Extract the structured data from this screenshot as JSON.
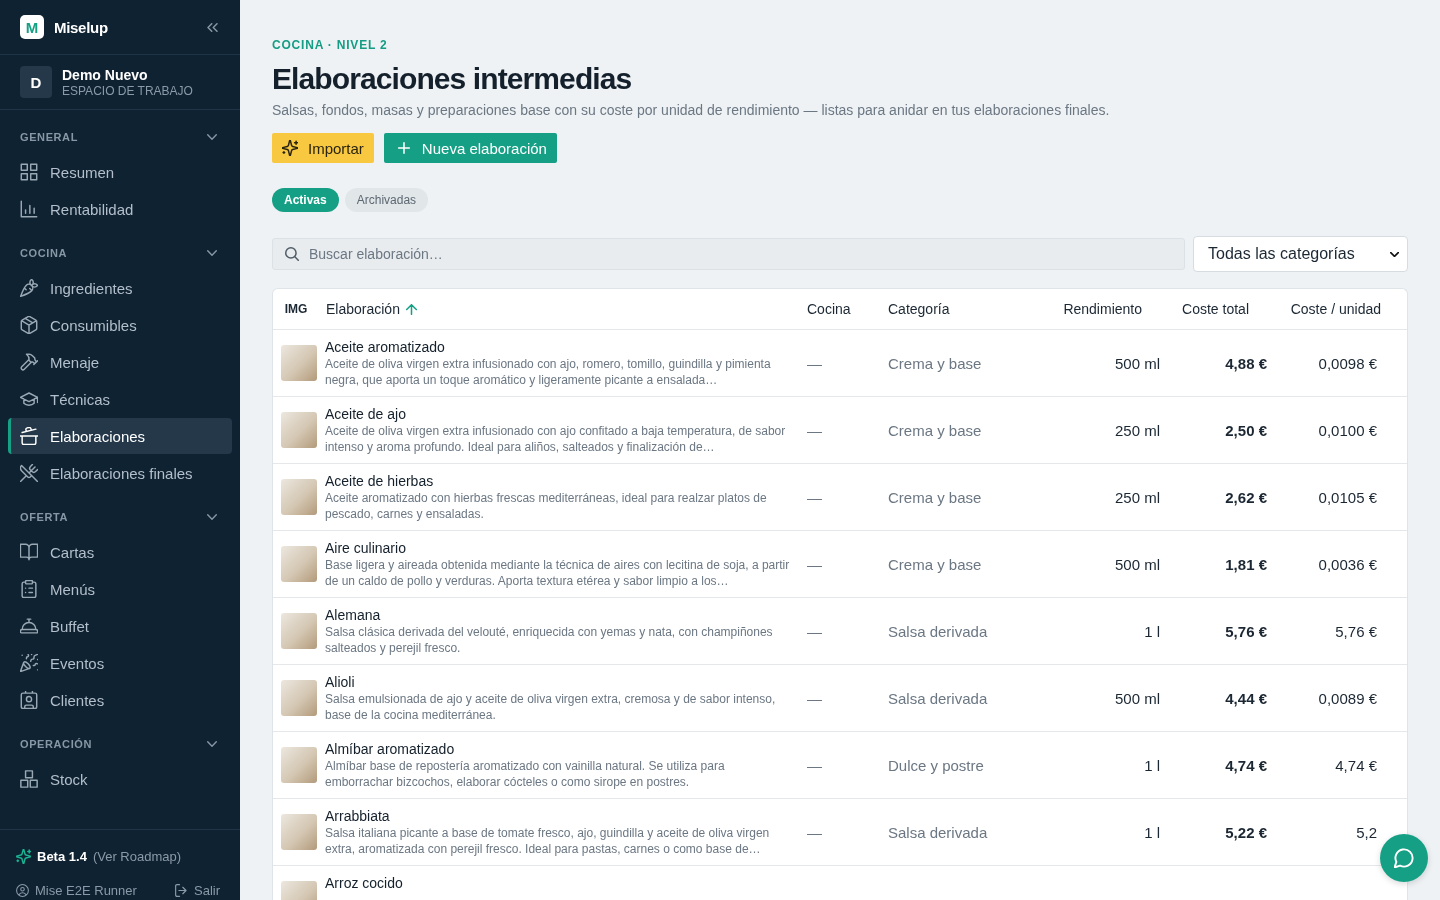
{
  "sidebar": {
    "brand": {
      "mark": "M",
      "name": "Miselup"
    },
    "workspace": {
      "initial": "D",
      "name": "Demo Nuevo",
      "label": "ESPACIO DE TRABAJO"
    },
    "sections": [
      {
        "title": "GENERAL",
        "expanded": true,
        "items": [
          {
            "label": "Resumen",
            "selected": false
          },
          {
            "label": "Rentabilidad",
            "selected": false
          }
        ]
      },
      {
        "title": "COCINA",
        "expanded": true,
        "items": [
          {
            "label": "Ingredientes",
            "selected": false
          },
          {
            "label": "Consumibles",
            "selected": false
          },
          {
            "label": "Menaje",
            "selected": false
          },
          {
            "label": "Técnicas",
            "selected": false
          },
          {
            "label": "Elaboraciones",
            "selected": true
          },
          {
            "label": "Elaboraciones finales",
            "selected": false
          }
        ]
      },
      {
        "title": "OFERTA",
        "expanded": true,
        "items": [
          {
            "label": "Cartas",
            "selected": false
          },
          {
            "label": "Menús",
            "selected": false
          },
          {
            "label": "Buffet",
            "selected": false
          },
          {
            "label": "Eventos",
            "selected": false
          },
          {
            "label": "Clientes",
            "selected": false
          }
        ]
      },
      {
        "title": "OPERACIÓN",
        "expanded": true,
        "items": [
          {
            "label": "Stock",
            "selected": false
          }
        ]
      }
    ],
    "footer": {
      "version": "Beta 1.4",
      "link": "(Ver Roadmap)",
      "user": "Mise E2E Runner",
      "logout": "Salir"
    }
  },
  "header": {
    "breadcrumb": "COCINA · NIVEL 2",
    "title": "Elaboraciones intermedias",
    "subtitle": "Salsas, fondos, masas y preparaciones base con su coste por unidad de rendimiento — listas para anidar en tus elaboraciones finales."
  },
  "actions": [
    {
      "label": "Importar",
      "kind": "accent"
    },
    {
      "label": "Nueva elaboración",
      "kind": "primary"
    }
  ],
  "tabs": [
    {
      "label": "Activas",
      "selected": true
    },
    {
      "label": "Archivadas",
      "selected": false
    }
  ],
  "search": {
    "placeholder": "Buscar elaboración…"
  },
  "category_filter": {
    "value": "Todas las categorías"
  },
  "table": {
    "columns": [
      {
        "label": "IMG",
        "sorted": false
      },
      {
        "label": "Elaboración",
        "sorted": true
      },
      {
        "label": "Cocina",
        "sorted": false
      },
      {
        "label": "Categoría",
        "sorted": false
      },
      {
        "label": "Rendimiento",
        "sorted": false
      },
      {
        "label": "Coste total",
        "sorted": false
      },
      {
        "label": "Coste / unidad",
        "sorted": false
      }
    ],
    "rows": [
      {
        "name": "Aceite aromatizado",
        "description": "Aceite de oliva virgen extra infusionado con ajo, romero, tomillo, guindilla y pimienta negra, que aporta un toque aromático y ligeramente picante a ensalada…",
        "kitchen": "—",
        "category": "Crema y base",
        "yield": "500 ml",
        "total_cost": "4,88 €",
        "unit_cost": "0,0098 €"
      },
      {
        "name": "Aceite de ajo",
        "description": "Aceite de oliva virgen extra infusionado con ajo confitado a baja temperatura, de sabor intenso y aroma profundo. Ideal para aliños, salteados y finalización de…",
        "kitchen": "—",
        "category": "Crema y base",
        "yield": "250 ml",
        "total_cost": "2,50 €",
        "unit_cost": "0,0100 €"
      },
      {
        "name": "Aceite de hierbas",
        "description": "Aceite aromatizado con hierbas frescas mediterráneas, ideal para realzar platos de pescado, carnes y ensaladas.",
        "kitchen": "—",
        "category": "Crema y base",
        "yield": "250 ml",
        "total_cost": "2,62 €",
        "unit_cost": "0,0105 €"
      },
      {
        "name": "Aire culinario",
        "description": "Base ligera y aireada obtenida mediante la técnica de aires con lecitina de soja, a partir de un caldo de pollo y verduras. Aporta textura etérea y sabor limpio a los…",
        "kitchen": "—",
        "category": "Crema y base",
        "yield": "500 ml",
        "total_cost": "1,81 €",
        "unit_cost": "0,0036 €"
      },
      {
        "name": "Alemana",
        "description": "Salsa clásica derivada del velouté, enriquecida con yemas y nata, con champiñones salteados y perejil fresco.",
        "kitchen": "—",
        "category": "Salsa derivada",
        "yield": "1 l",
        "total_cost": "5,76 €",
        "unit_cost": "5,76 €"
      },
      {
        "name": "Alioli",
        "description": "Salsa emulsionada de ajo y aceite de oliva virgen extra, cremosa y de sabor intenso, base de la cocina mediterránea.",
        "kitchen": "—",
        "category": "Salsa derivada",
        "yield": "500 ml",
        "total_cost": "4,44 €",
        "unit_cost": "0,0089 €"
      },
      {
        "name": "Almíbar aromatizado",
        "description": "Almíbar base de repostería aromatizado con vainilla natural. Se utiliza para emborrachar bizcochos, elaborar cócteles o como sirope en postres.",
        "kitchen": "—",
        "category": "Dulce y postre",
        "yield": "1 l",
        "total_cost": "4,74 €",
        "unit_cost": "4,74 €"
      },
      {
        "name": "Arrabbiata",
        "description": "Salsa italiana picante a base de tomate fresco, ajo, guindilla y aceite de oliva virgen extra, aromatizada con perejil fresco. Ideal para pastas, carnes o como base de…",
        "kitchen": "—",
        "category": "Salsa derivada",
        "yield": "1 l",
        "total_cost": "5,22 €",
        "unit_cost": "5,2"
      },
      {
        "name": "Arroz cocido"
      }
    ]
  }
}
